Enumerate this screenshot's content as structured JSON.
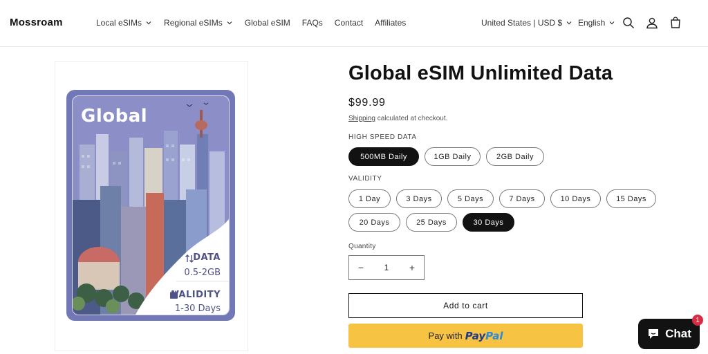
{
  "header": {
    "logo": "Mossroam",
    "nav": [
      {
        "label": "Local eSIMs",
        "has_dropdown": true
      },
      {
        "label": "Regional eSIMs",
        "has_dropdown": true
      },
      {
        "label": "Global eSIM",
        "has_dropdown": false
      },
      {
        "label": "FAQs",
        "has_dropdown": false
      },
      {
        "label": "Contact",
        "has_dropdown": false
      },
      {
        "label": "Affiliates",
        "has_dropdown": false
      }
    ],
    "country_currency": "United States | USD $",
    "language": "English",
    "icons": [
      "search-icon",
      "account-icon",
      "cart-icon"
    ]
  },
  "product_image": {
    "title": "Global",
    "data_label": "DATA",
    "data_value": "0.5-2GB",
    "validity_label": "VALIDITY",
    "validity_value": "1-30 Days",
    "colors": {
      "frame": "#7277b5",
      "sky": "#8c8fc7",
      "text": "#4f5287"
    }
  },
  "product": {
    "title": "Global eSIM Unlimited Data",
    "price": "$99.99",
    "shipping_link": "Shipping",
    "shipping_note": " calculated at checkout."
  },
  "options": {
    "high_speed_label": "HIGH SPEED DATA",
    "high_speed": [
      {
        "label": "500MB Daily",
        "selected": true
      },
      {
        "label": "1GB Daily",
        "selected": false
      },
      {
        "label": "2GB Daily",
        "selected": false
      }
    ],
    "validity_label": "VALIDITY",
    "validity": [
      {
        "label": "1 Day",
        "selected": false
      },
      {
        "label": "3 Days",
        "selected": false
      },
      {
        "label": "5 Days",
        "selected": false
      },
      {
        "label": "7 Days",
        "selected": false
      },
      {
        "label": "10 Days",
        "selected": false
      },
      {
        "label": "15 Days",
        "selected": false
      },
      {
        "label": "20 Days",
        "selected": false
      },
      {
        "label": "25 Days",
        "selected": false
      },
      {
        "label": "30 Days",
        "selected": true
      }
    ]
  },
  "quantity": {
    "label": "Quantity",
    "value": "1",
    "minus": "−",
    "plus": "+"
  },
  "buttons": {
    "add_to_cart": "Add to cart",
    "paypal_prefix": "Pay with",
    "paypal_brand_pay": "Pay",
    "paypal_brand_pal": "Pal"
  },
  "chat": {
    "label": "Chat",
    "badge": "1"
  },
  "colors": {
    "accent": "#121212",
    "paypal": "#f6c343",
    "badge": "#d72c44"
  }
}
